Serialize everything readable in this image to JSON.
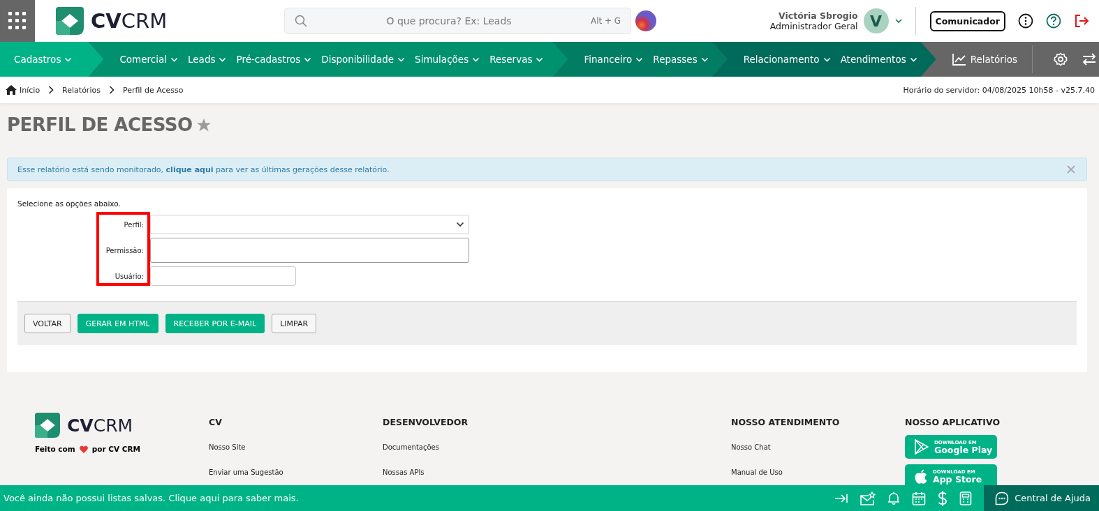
{
  "header": {
    "logo": "**CV**CRM",
    "search": {
      "placeholder": "O que procura? Ex: Leads",
      "shortcut": "Alt + G"
    },
    "user": {
      "name": "Victória Sbrogio",
      "role": "Administrador Geral",
      "initial": "V"
    },
    "communicator": "Comunicador"
  },
  "nav": {
    "segments": [
      {
        "kind": "light",
        "items": [
          "Cadastros"
        ]
      },
      {
        "kind": "mid",
        "items": [
          "Comercial",
          "Leads",
          "Pré-cadastros",
          "Disponibilidade",
          "Simulações",
          "Reservas"
        ]
      },
      {
        "kind": "deep",
        "items": [
          "Financeiro",
          "Repasses"
        ]
      },
      {
        "kind": "dark",
        "items": [
          "Relacionamento",
          "Atendimentos"
        ]
      }
    ],
    "reports": "Relatórios"
  },
  "breadcrumb": [
    "Início",
    "Relatórios",
    "Perfil de Acesso"
  ],
  "server_time": "Horário do servidor: 04/08/2025 10h58 - v25.7.40",
  "page_title": "PERFIL DE ACESSO",
  "alert": {
    "text": "Esse relatório está sendo monitorado, **clique aqui** para ver as últimas gerações desse relatório."
  },
  "form": {
    "intro": "Selecione as opções abaixo.",
    "fields": [
      {
        "label": "Perfil:",
        "kind": "select"
      },
      {
        "label": "Permissão:",
        "kind": "tall"
      },
      {
        "label": "Usuário:",
        "kind": "short"
      }
    ],
    "buttons": [
      {
        "label": "VOLTAR",
        "kind": "plain"
      },
      {
        "label": "GERAR EM HTML",
        "kind": "primary"
      },
      {
        "label": "RECEBER POR E-MAIL",
        "kind": "primary"
      },
      {
        "label": "LIMPAR",
        "kind": "plain"
      }
    ]
  },
  "footer": {
    "logo": "**CV**CRM",
    "made_with": {
      "before": "Feito com",
      "after": "por CV CRM"
    },
    "columns": [
      {
        "title": "CV",
        "links": [
          "Nosso Site",
          "Enviar uma Sugestão"
        ]
      },
      {
        "title": "DESENVOLVEDOR",
        "links": [
          "Documentações",
          "Nossas APIs"
        ]
      },
      {
        "title": "NOSSO ATENDIMENTO",
        "links": [
          "Nosso Chat",
          "Manual de Uso"
        ]
      }
    ],
    "app": {
      "title": "NOSSO APLICATIVO",
      "stores": [
        {
          "kind": "google",
          "small": "DOWNLOAD EM",
          "big": "Google Play"
        },
        {
          "kind": "apple",
          "small": "DOWNLOAD EM",
          "big": "App Store"
        }
      ]
    }
  },
  "status_bar": {
    "message": "Você ainda não possui listas salvas. Clique aqui para saber mais.",
    "help": "Central de Ajuda"
  }
}
